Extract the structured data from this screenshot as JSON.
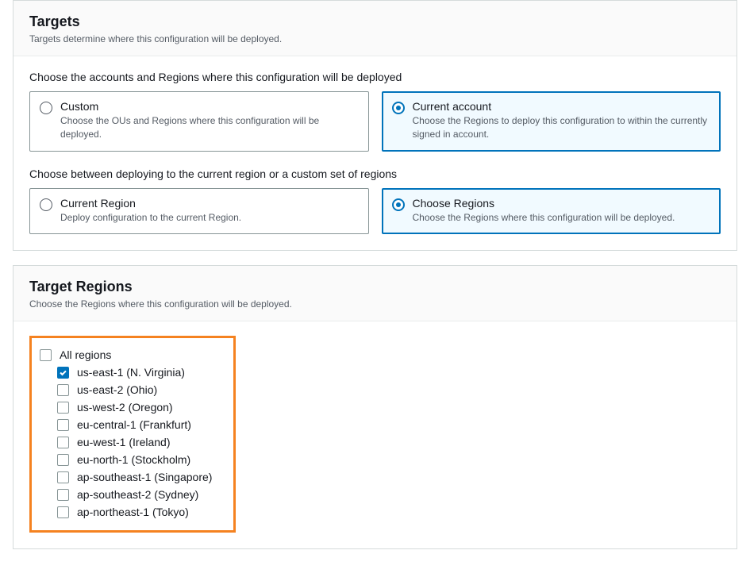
{
  "targets_panel": {
    "title": "Targets",
    "subtitle": "Targets determine where this configuration will be deployed.",
    "accounts_label": "Choose the accounts and Regions where this configuration will be deployed",
    "custom": {
      "title": "Custom",
      "desc": "Choose the OUs and Regions where this configuration will be deployed."
    },
    "current_account": {
      "title": "Current account",
      "desc": "Choose the Regions to deploy this configuration to within the currently signed in account."
    },
    "regions_mode_label": "Choose between deploying to the current region or a custom set of regions",
    "current_region": {
      "title": "Current Region",
      "desc": "Deploy configuration to the current Region."
    },
    "choose_regions": {
      "title": "Choose Regions",
      "desc": "Choose the Regions where this configuration will be deployed."
    }
  },
  "regions_panel": {
    "title": "Target Regions",
    "subtitle": "Choose the Regions where this configuration will be deployed.",
    "all_label": "All regions",
    "items": [
      {
        "label": "us-east-1 (N. Virginia)",
        "checked": true
      },
      {
        "label": "us-east-2 (Ohio)",
        "checked": false
      },
      {
        "label": "us-west-2 (Oregon)",
        "checked": false
      },
      {
        "label": "eu-central-1 (Frankfurt)",
        "checked": false
      },
      {
        "label": "eu-west-1 (Ireland)",
        "checked": false
      },
      {
        "label": "eu-north-1 (Stockholm)",
        "checked": false
      },
      {
        "label": "ap-southeast-1 (Singapore)",
        "checked": false
      },
      {
        "label": "ap-southeast-2 (Sydney)",
        "checked": false
      },
      {
        "label": "ap-northeast-1 (Tokyo)",
        "checked": false
      }
    ]
  }
}
